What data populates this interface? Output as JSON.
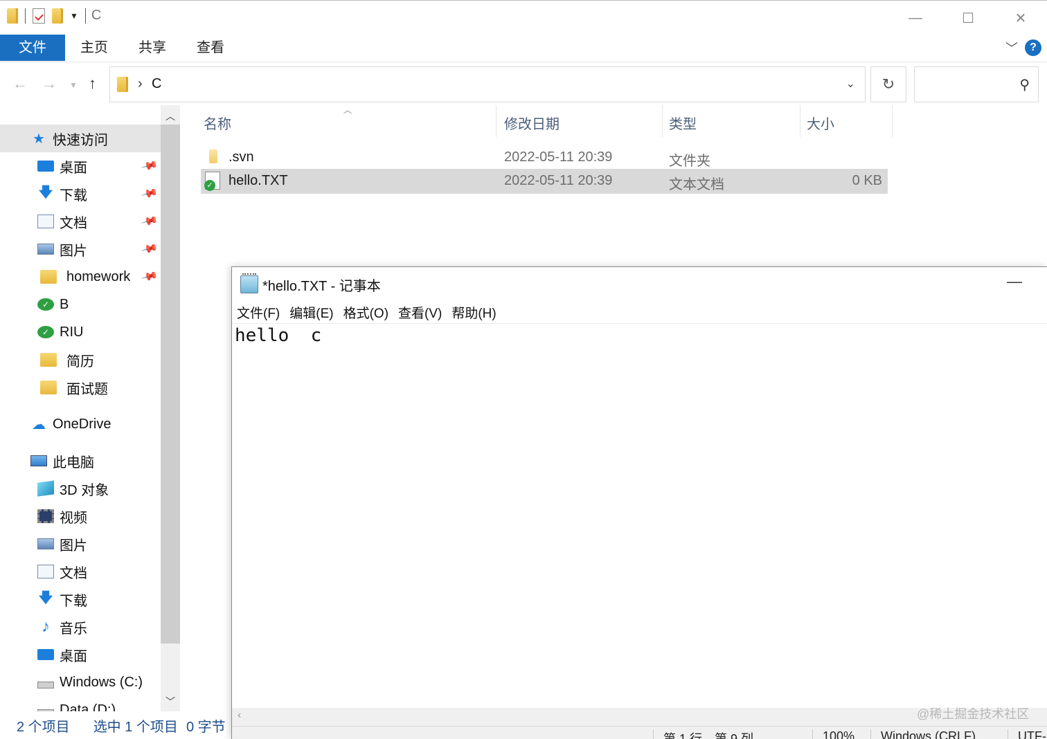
{
  "explorer": {
    "title_path": "C",
    "ribbon_tabs": [
      "文件",
      "主页",
      "共享",
      "查看"
    ],
    "address": {
      "crumb": "C"
    },
    "sidebar": {
      "quick_access": "快速访问",
      "quick_items": [
        {
          "label": "桌面",
          "icon": "desktop-icon"
        },
        {
          "label": "下载",
          "icon": "download-icon"
        },
        {
          "label": "文档",
          "icon": "document-icon"
        },
        {
          "label": "图片",
          "icon": "pictures-icon"
        },
        {
          "label": "homework",
          "icon": "folder-icon"
        },
        {
          "label": "B",
          "icon": "svn-folder-icon"
        },
        {
          "label": "RIU",
          "icon": "svn-folder-icon"
        },
        {
          "label": "简历",
          "icon": "folder-icon"
        },
        {
          "label": "面试题",
          "icon": "folder-icon"
        }
      ],
      "onedrive": "OneDrive",
      "this_pc": "此电脑",
      "pc_items": [
        {
          "label": "3D 对象",
          "icon": "3d-objects-icon"
        },
        {
          "label": "视频",
          "icon": "videos-icon"
        },
        {
          "label": "图片",
          "icon": "pictures-icon"
        },
        {
          "label": "文档",
          "icon": "document-icon"
        },
        {
          "label": "下载",
          "icon": "download-icon"
        },
        {
          "label": "音乐",
          "icon": "music-icon"
        },
        {
          "label": "桌面",
          "icon": "desktop-icon"
        },
        {
          "label": "Windows (C:)",
          "icon": "drive-icon"
        },
        {
          "label": "Data (D:)",
          "icon": "drive-icon"
        }
      ]
    },
    "columns": {
      "name": "名称",
      "modified": "修改日期",
      "type": "类型",
      "size": "大小"
    },
    "files": [
      {
        "name": ".svn",
        "modified": "2022-05-11 20:39",
        "type": "文件夹",
        "size": ""
      },
      {
        "name": "hello.TXT",
        "modified": "2022-05-11 20:39",
        "type": "文本文档",
        "size": "0 KB"
      }
    ],
    "status": {
      "count": "2 个项目",
      "selection": "选中 1 个项目",
      "bytes": "0 字节"
    }
  },
  "notepad": {
    "title": "*hello.TXT - 记事本",
    "menu": [
      "文件(F)",
      "编辑(E)",
      "格式(O)",
      "查看(V)",
      "帮助(H)"
    ],
    "content": "hello  c",
    "status": {
      "position": "第 1 行，第 9 列",
      "zoom": "100%",
      "eol": "Windows (CRLF)",
      "encoding": "UTF-"
    }
  },
  "watermark": "@稀土掘金技术社区",
  "colors": {
    "accent": "#1a6fc1",
    "selection": "#d9d9d9",
    "svn_green": "#2ea043"
  }
}
